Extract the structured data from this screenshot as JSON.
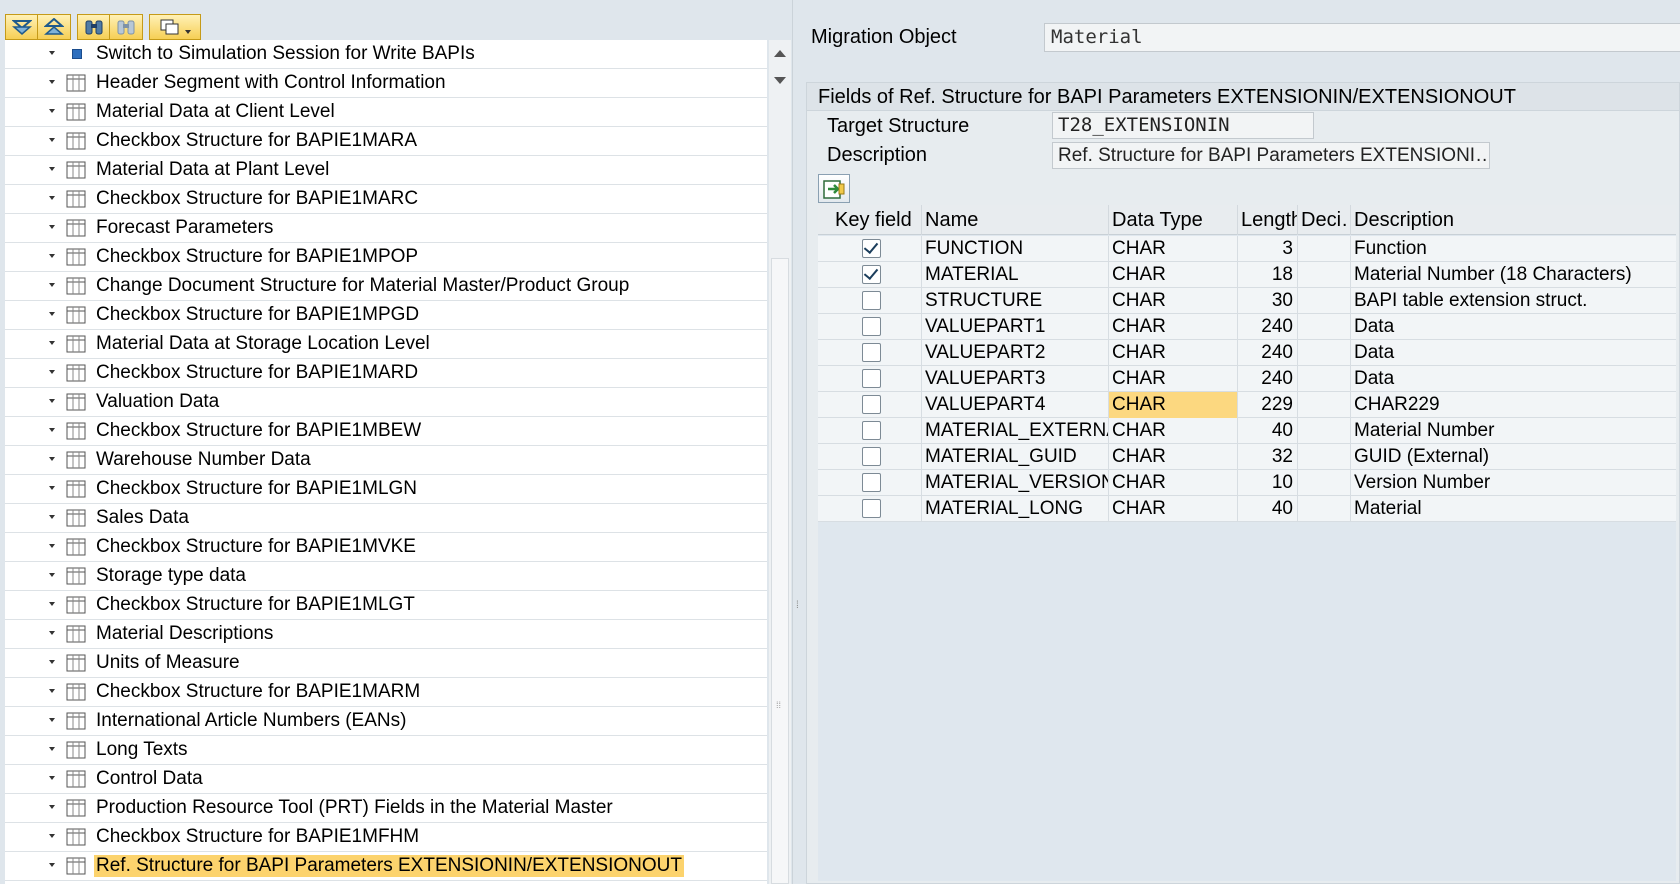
{
  "tree": {
    "items": [
      {
        "label": "Switch to Simulation Session for Write BAPIs",
        "icon": "square-icon"
      },
      {
        "label": "Header Segment with Control Information",
        "icon": "table-icon"
      },
      {
        "label": "Material Data at Client Level",
        "icon": "table-icon"
      },
      {
        "label": "Checkbox Structure for BAPIE1MARA",
        "icon": "table-icon"
      },
      {
        "label": "Material Data at Plant Level",
        "icon": "table-icon"
      },
      {
        "label": "Checkbox Structure for BAPIE1MARC",
        "icon": "table-icon"
      },
      {
        "label": "Forecast Parameters",
        "icon": "table-icon"
      },
      {
        "label": "Checkbox Structure for BAPIE1MPOP",
        "icon": "table-icon"
      },
      {
        "label": "Change Document Structure for Material Master/Product Group",
        "icon": "table-icon"
      },
      {
        "label": "Checkbox Structure for BAPIE1MPGD",
        "icon": "table-icon"
      },
      {
        "label": "Material Data at Storage Location Level",
        "icon": "table-icon"
      },
      {
        "label": "Checkbox Structure for BAPIE1MARD",
        "icon": "table-icon"
      },
      {
        "label": "Valuation Data",
        "icon": "table-icon"
      },
      {
        "label": "Checkbox Structure for BAPIE1MBEW",
        "icon": "table-icon"
      },
      {
        "label": "Warehouse Number Data",
        "icon": "table-icon"
      },
      {
        "label": "Checkbox Structure for BAPIE1MLGN",
        "icon": "table-icon"
      },
      {
        "label": "Sales Data",
        "icon": "table-icon"
      },
      {
        "label": "Checkbox Structure for BAPIE1MVKE",
        "icon": "table-icon"
      },
      {
        "label": "Storage type data",
        "icon": "table-icon"
      },
      {
        "label": "Checkbox Structure for BAPIE1MLGT",
        "icon": "table-icon"
      },
      {
        "label": "Material Descriptions",
        "icon": "table-icon"
      },
      {
        "label": "Units of Measure",
        "icon": "table-icon"
      },
      {
        "label": "Checkbox Structure for BAPIE1MARM",
        "icon": "table-icon"
      },
      {
        "label": "International Article Numbers (EANs)",
        "icon": "table-icon"
      },
      {
        "label": "Long Texts",
        "icon": "table-icon"
      },
      {
        "label": "Control Data",
        "icon": "table-icon"
      },
      {
        "label": "Production Resource Tool (PRT) Fields in the Material Master",
        "icon": "table-icon"
      },
      {
        "label": "Checkbox Structure for BAPIE1MFHM",
        "icon": "table-icon"
      },
      {
        "label": "Ref. Structure for BAPI Parameters EXTENSIONIN/EXTENSIONOUT",
        "icon": "table-icon",
        "selected": true
      }
    ]
  },
  "migration": {
    "label": "Migration Object",
    "value": "Material"
  },
  "group": {
    "title": "Fields of Ref. Structure for BAPI Parameters EXTENSIONIN/EXTENSIONOUT",
    "target_label": "Target Structure",
    "target_value": "T28_EXTENSIONIN",
    "desc_label": "Description",
    "desc_value": "Ref. Structure for BAPI Parameters EXTENSIONI…"
  },
  "table": {
    "headers": [
      "Key field",
      "Name",
      "Data Type",
      "Length",
      "Deci…",
      "Description"
    ],
    "rows": [
      {
        "key": true,
        "name": "FUNCTION",
        "type": "CHAR",
        "length": "3",
        "deci": "",
        "desc": "Function"
      },
      {
        "key": true,
        "name": "MATERIAL",
        "type": "CHAR",
        "length": "18",
        "deci": "",
        "desc": "Material Number (18 Characters)"
      },
      {
        "key": false,
        "name": "STRUCTURE",
        "type": "CHAR",
        "length": "30",
        "deci": "",
        "desc": "BAPI table extension struct."
      },
      {
        "key": false,
        "name": "VALUEPART1",
        "type": "CHAR",
        "length": "240",
        "deci": "",
        "desc": "Data"
      },
      {
        "key": false,
        "name": "VALUEPART2",
        "type": "CHAR",
        "length": "240",
        "deci": "",
        "desc": "Data"
      },
      {
        "key": false,
        "name": "VALUEPART3",
        "type": "CHAR",
        "length": "240",
        "deci": "",
        "desc": "Data"
      },
      {
        "key": false,
        "name": "VALUEPART4",
        "type": "CHAR",
        "length": "229",
        "deci": "",
        "desc": "CHAR229",
        "highlight": true
      },
      {
        "key": false,
        "name": "MATERIAL_EXTERNAL",
        "type": "CHAR",
        "length": "40",
        "deci": "",
        "desc": "Material Number"
      },
      {
        "key": false,
        "name": "MATERIAL_GUID",
        "type": "CHAR",
        "length": "32",
        "deci": "",
        "desc": "GUID (External)"
      },
      {
        "key": false,
        "name": "MATERIAL_VERSION",
        "type": "CHAR",
        "length": "10",
        "deci": "",
        "desc": "Version Number"
      },
      {
        "key": false,
        "name": "MATERIAL_LONG",
        "type": "CHAR",
        "length": "40",
        "deci": "",
        "desc": "Material"
      }
    ]
  },
  "colors": {
    "selection": "#fcd36d",
    "cell_highlight": "#fcd880",
    "toolbar_button": "#f6cf55"
  }
}
